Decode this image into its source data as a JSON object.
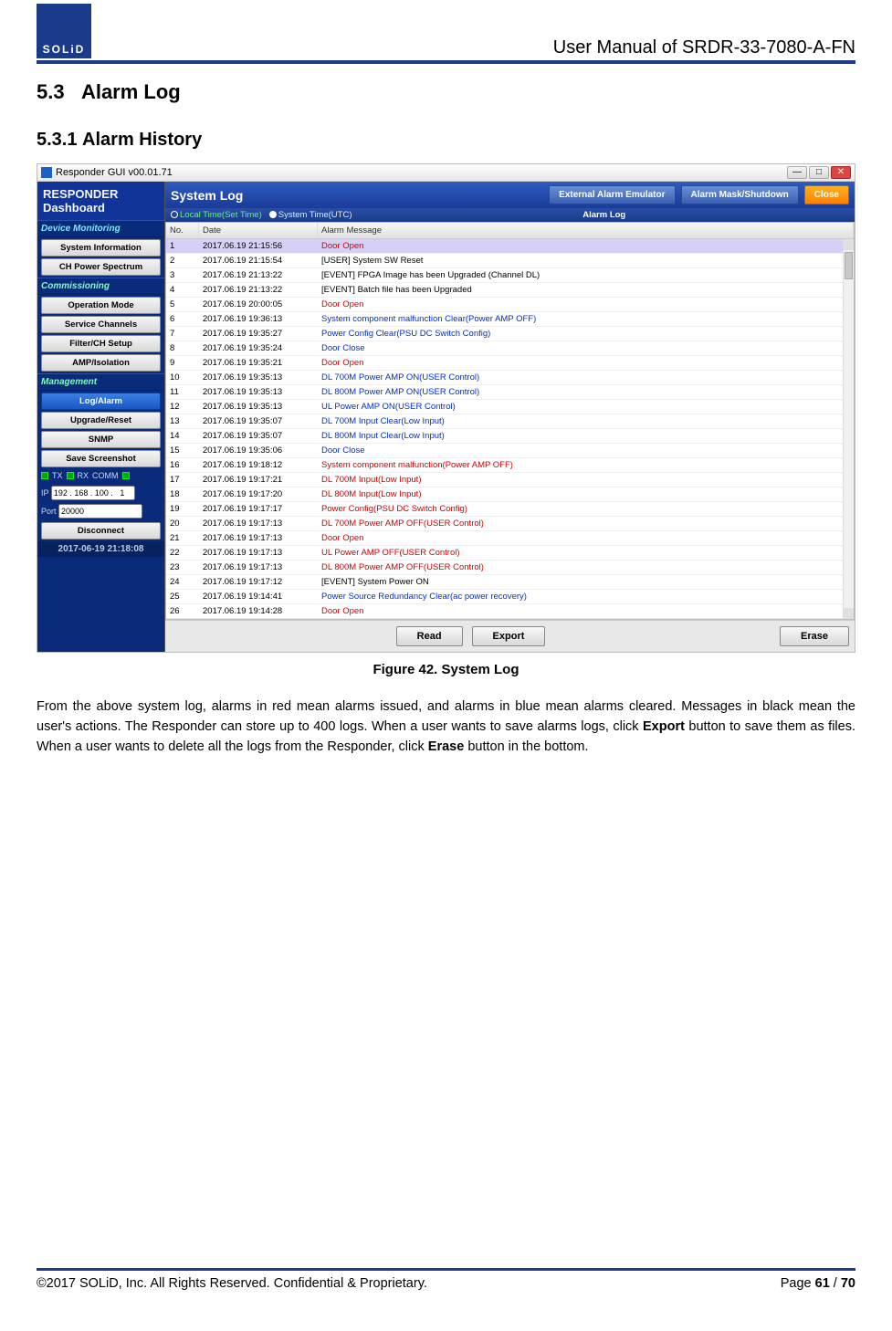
{
  "header_title": "User Manual of SRDR-33-7080-A-FN",
  "logo_text": "SOLiD",
  "section_num": "5.3",
  "section_title": "Alarm Log",
  "subsection_num": "5.3.1",
  "subsection_title": "Alarm History",
  "screenshot": {
    "window_title": "Responder GUI v00.01.71",
    "sidebar": {
      "title_line1": "RESPONDER",
      "title_line2": "Dashboard",
      "groups": [
        {
          "title": "Device Monitoring",
          "items": [
            "System Information",
            "CH Power Spectrum"
          ]
        },
        {
          "title": "Commissioning",
          "items": [
            "Operation Mode",
            "Service Channels",
            "Filter/CH Setup",
            "AMP/Isolation"
          ]
        },
        {
          "title": "Management",
          "items": [
            "Log/Alarm",
            "Upgrade/Reset",
            "SNMP",
            "Save Screenshot"
          ]
        }
      ],
      "ip_label": "IP",
      "ip_value": "192 . 168 . 100 .   1",
      "port_label": "Port",
      "port_value": "20000",
      "tx": "TX",
      "rx": "RX",
      "comm": "COMM",
      "disconnect": "Disconnect",
      "timestamp": "2017-06-19 21:18:08"
    },
    "topbar": {
      "title": "System Log",
      "btn_ext": "External Alarm Emulator",
      "btn_mask": "Alarm Mask/Shutdown",
      "btn_close": "Close"
    },
    "subbar": {
      "local_label": "Local Time(Set Time)",
      "utc_label": "System Time(UTC)",
      "center": "Alarm Log"
    },
    "grid": {
      "col_no": "No.",
      "col_date": "Date",
      "col_msg": "Alarm Message",
      "rows": [
        {
          "no": "1",
          "date": "2017.06.19 21:15:56",
          "msg": "Door Open",
          "c": "red",
          "sel": true
        },
        {
          "no": "2",
          "date": "2017.06.19 21:15:54",
          "msg": "[USER] System SW Reset",
          "c": "black"
        },
        {
          "no": "3",
          "date": "2017.06.19 21:13:22",
          "msg": "[EVENT] FPGA Image has been Upgraded (Channel DL)",
          "c": "black"
        },
        {
          "no": "4",
          "date": "2017.06.19 21:13:22",
          "msg": "[EVENT] Batch file has been Upgraded",
          "c": "black"
        },
        {
          "no": "5",
          "date": "2017.06.19 20:00:05",
          "msg": "Door Open",
          "c": "red"
        },
        {
          "no": "6",
          "date": "2017.06.19 19:36:13",
          "msg": "System component malfunction Clear(Power AMP OFF)",
          "c": "blue"
        },
        {
          "no": "7",
          "date": "2017.06.19 19:35:27",
          "msg": "Power Config Clear(PSU DC Switch Config)",
          "c": "blue"
        },
        {
          "no": "8",
          "date": "2017.06.19 19:35:24",
          "msg": "Door Close",
          "c": "blue"
        },
        {
          "no": "9",
          "date": "2017.06.19 19:35:21",
          "msg": "Door Open",
          "c": "red"
        },
        {
          "no": "10",
          "date": "2017.06.19 19:35:13",
          "msg": "DL 700M Power AMP ON(USER Control)",
          "c": "blue"
        },
        {
          "no": "11",
          "date": "2017.06.19 19:35:13",
          "msg": "DL 800M Power AMP ON(USER Control)",
          "c": "blue"
        },
        {
          "no": "12",
          "date": "2017.06.19 19:35:13",
          "msg": "UL Power AMP ON(USER Control)",
          "c": "blue"
        },
        {
          "no": "13",
          "date": "2017.06.19 19:35:07",
          "msg": "DL 700M Input Clear(Low Input)",
          "c": "blue"
        },
        {
          "no": "14",
          "date": "2017.06.19 19:35:07",
          "msg": "DL 800M Input Clear(Low Input)",
          "c": "blue"
        },
        {
          "no": "15",
          "date": "2017.06.19 19:35:06",
          "msg": "Door Close",
          "c": "blue"
        },
        {
          "no": "16",
          "date": "2017.06.19 19:18:12",
          "msg": "System component malfunction(Power AMP OFF)",
          "c": "red"
        },
        {
          "no": "17",
          "date": "2017.06.19 19:17:21",
          "msg": "DL 700M Input(Low Input)",
          "c": "red"
        },
        {
          "no": "18",
          "date": "2017.06.19 19:17:20",
          "msg": "DL 800M Input(Low Input)",
          "c": "red"
        },
        {
          "no": "19",
          "date": "2017.06.19 19:17:17",
          "msg": "Power Config(PSU DC Switch Config)",
          "c": "red"
        },
        {
          "no": "20",
          "date": "2017.06.19 19:17:13",
          "msg": "DL 700M Power AMP OFF(USER Control)",
          "c": "red"
        },
        {
          "no": "21",
          "date": "2017.06.19 19:17:13",
          "msg": "Door Open",
          "c": "red"
        },
        {
          "no": "22",
          "date": "2017.06.19 19:17:13",
          "msg": "UL Power AMP OFF(USER Control)",
          "c": "red"
        },
        {
          "no": "23",
          "date": "2017.06.19 19:17:13",
          "msg": "DL 800M Power AMP OFF(USER Control)",
          "c": "red"
        },
        {
          "no": "24",
          "date": "2017.06.19 19:17:12",
          "msg": "[EVENT] System Power ON",
          "c": "black"
        },
        {
          "no": "25",
          "date": "2017.06.19 19:14:41",
          "msg": "Power Source Redundancy Clear(ac power recovery)",
          "c": "blue"
        },
        {
          "no": "26",
          "date": "2017.06.19 19:14:28",
          "msg": "Door Open",
          "c": "red"
        }
      ],
      "btn_read": "Read",
      "btn_export": "Export",
      "btn_erase": "Erase"
    }
  },
  "figure_caption": "Figure 42. System Log",
  "body": {
    "p1a": "From the above system log, alarms in red mean alarms issued, and alarms in blue mean alarms cleared. Messages in black mean the user's actions. The Responder can store up to 400 logs. When a user wants to save alarms logs, click ",
    "p1b": "Export",
    "p1c": " button to save them as files. When a user wants to delete all the logs from the Responder, click ",
    "p1d": "Erase",
    "p1e": " button in the bottom."
  },
  "footer": {
    "left": "©2017 SOLiD, Inc. All Rights Reserved. Confidential & Proprietary.",
    "right_prefix": "Page ",
    "right_page": "61",
    "right_sep": " / ",
    "right_total": "70"
  }
}
